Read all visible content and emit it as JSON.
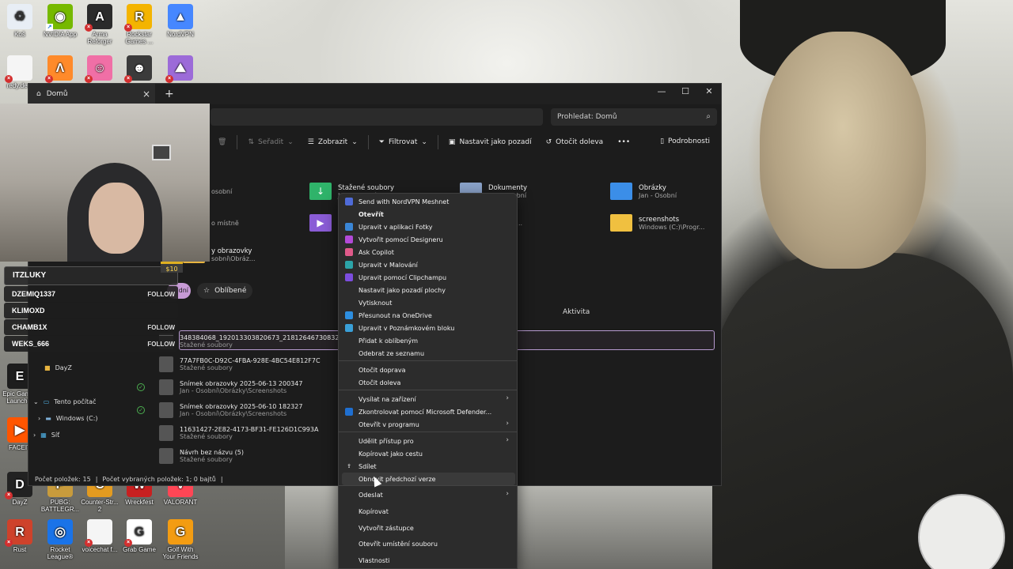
{
  "desktop": {
    "icons": [
      {
        "label": "Koš",
        "icon": "recycle-bin-icon",
        "color": "#e8eef5",
        "glyph": "♻",
        "badge": ""
      },
      {
        "label": "NVIDIA App",
        "icon": "nvidia-icon",
        "color": "#76b900",
        "glyph": "◉",
        "badge": "arrow"
      },
      {
        "label": "Arma Reforger",
        "icon": "arma-icon",
        "color": "#2b2b2b",
        "glyph": "A",
        "badge": "x"
      },
      {
        "label": "Rockstar Games ...",
        "icon": "rockstar-icon",
        "color": "#f4b400",
        "glyph": "R",
        "badge": "x"
      },
      {
        "label": "NordVPN",
        "icon": "nordvpn-icon",
        "color": "#4687ff",
        "glyph": "▲",
        "badge": ""
      },
      {
        "label": "redy.de...",
        "icon": "file-icon",
        "color": "#f5f5f5",
        "glyph": "",
        "badge": "x"
      },
      {
        "label": "",
        "icon": "fl-studio-icon",
        "color": "#ff8a2a",
        "glyph": "Λ",
        "badge": "x"
      },
      {
        "label": "",
        "icon": "mascot-icon",
        "color": "#f06fa6",
        "glyph": "☺",
        "badge": "x"
      },
      {
        "label": "",
        "icon": "character-icon",
        "color": "#3b3b3b",
        "glyph": "☻",
        "badge": "x"
      },
      {
        "label": "",
        "icon": "mountain-icon",
        "color": "#9c6bd8",
        "glyph": "⛰",
        "badge": "x"
      },
      {
        "label": "Epic Games Launcher",
        "icon": "epic-games-icon",
        "color": "#1d1d1d",
        "glyph": "E",
        "badge": ""
      },
      {
        "label": "FACEIT",
        "icon": "faceit-icon",
        "color": "#ff5500",
        "glyph": "▶",
        "badge": ""
      },
      {
        "label": "DayZ",
        "icon": "dayz-icon",
        "color": "#222",
        "glyph": "D",
        "badge": "x"
      },
      {
        "label": "PUBG: BATTLEGR...",
        "icon": "pubg-icon",
        "color": "#c89b3c",
        "glyph": "P",
        "badge": ""
      },
      {
        "label": "Counter-Str... 2",
        "icon": "cs2-icon",
        "color": "#e39b20",
        "glyph": "C",
        "badge": ""
      },
      {
        "label": "Wreckfest",
        "icon": "wreckfest-icon",
        "color": "#c82020",
        "glyph": "W",
        "badge": ""
      },
      {
        "label": "VALORANT",
        "icon": "valorant-icon",
        "color": "#ff4655",
        "glyph": "V",
        "badge": ""
      },
      {
        "label": "Rust",
        "icon": "rust-icon",
        "color": "#ce422b",
        "glyph": "R",
        "badge": "x"
      },
      {
        "label": "Rocket League®",
        "icon": "rocket-league-icon",
        "color": "#1a73e8",
        "glyph": "◎",
        "badge": ""
      },
      {
        "label": "voicechat f...",
        "icon": "file-icon",
        "color": "#f5f5f5",
        "glyph": "",
        "badge": "x"
      },
      {
        "label": "Grab Game",
        "icon": "grab-game-icon",
        "color": "#ffffff",
        "glyph": "G",
        "badge": "x"
      },
      {
        "label": "Golf With Your Friends",
        "icon": "golf-icon",
        "color": "#f39c12",
        "glyph": "G",
        "badge": ""
      }
    ]
  },
  "explorer": {
    "tab_title": "Domů",
    "search_placeholder": "Prohledat: Domů",
    "toolbar": {
      "sort": "Seřadit",
      "view": "Zobrazit",
      "filter": "Filtrovat",
      "set_background": "Nastavit jako pozadí",
      "rotate_left": "Otočit doleva",
      "more": "•••",
      "details": "Podrobnosti"
    },
    "quick_access": [
      {
        "name": "",
        "sub": "osobní",
        "icon": "folder-icon",
        "color": "#e8b440"
      },
      {
        "name": "Stažené soubory",
        "sub": "Jan - Osobní",
        "icon": "downloads-folder-icon",
        "color": "#2fb36a"
      },
      {
        "name": "Dokumenty",
        "sub": "Jan - Osobní",
        "icon": "documents-folder-icon",
        "color": "#8aa2c8"
      },
      {
        "name": "Obrázky",
        "sub": "Jan - Osobní",
        "icon": "pictures-folder-icon",
        "color": "#3b8ee8"
      },
      {
        "name": "",
        "sub": "o místně",
        "icon": "folder-icon",
        "color": "#e8b440"
      },
      {
        "name": "",
        "sub": "",
        "icon": "videos-folder-icon",
        "color": "#8a5cd6"
      },
      {
        "name": "",
        "sub": "obi\\Doku...",
        "icon": "folder-icon",
        "color": "#e8b440"
      },
      {
        "name": "screenshots",
        "sub": "Windows (C:)\\Progr...",
        "icon": "folder-icon",
        "color": "#f0c040"
      },
      {
        "name": "y obrazovky",
        "sub": "sobní\\Obráz...",
        "icon": "folder-icon",
        "color": "#e8b440"
      }
    ],
    "pills": {
      "recent_fragment": "dní",
      "favorites": "Oblíbené"
    },
    "activity_header": "Aktivita",
    "files": [
      {
        "name": "348384068_192013303820673_2181264673083214185_n",
        "location": "Stažené soubory",
        "synced": false
      },
      {
        "name": "77A7FB0C-D92C-4FBA-928E-4BC54E812F7C",
        "location": "Stažené soubory",
        "synced": false
      },
      {
        "name": "Snímek obrazovky 2025-06-13 200347",
        "location": "Jan - Osobní\\Obrázky\\Screenshots",
        "synced": true
      },
      {
        "name": "Snímek obrazovky 2025-06-10 182327",
        "location": "Jan - Osobní\\Obrázky\\Screenshots",
        "synced": true
      },
      {
        "name": "11631427-2E82-4173-BF31-FE126D1C993A",
        "location": "Stažené soubory",
        "synced": false
      },
      {
        "name": "Návrh bez názvu (5)",
        "location": "Stažené soubory",
        "synced": false
      }
    ],
    "nav": {
      "dayz": "DayZ",
      "this_pc": "Tento počítač",
      "windows_c": "Windows (C:)",
      "network": "Síť"
    },
    "status": {
      "count": "Počet položek: 15",
      "selected": "Počet vybraných položek: 1; 0 bajtů"
    }
  },
  "chat": {
    "title": "ITZLUKY",
    "price": "$10",
    "rows": [
      {
        "user": "DZEMIQ1337",
        "action": "FOLLOW"
      },
      {
        "user": "KLIMOXD",
        "action": ""
      },
      {
        "user": "CHAMB1X",
        "action": "FOLLOW"
      },
      {
        "user": "WEKS_666",
        "action": "FOLLOW"
      }
    ]
  },
  "context_menu": {
    "items": [
      {
        "label": "Send with NordVPN Meshnet",
        "icon": "nordvpn-meshnet-icon",
        "color": "#4f6bd8",
        "bold": false,
        "submenu": false
      },
      {
        "label": "Otevřít",
        "icon": "",
        "color": "",
        "bold": true,
        "submenu": false
      },
      {
        "label": "Upravit v aplikaci Fotky",
        "icon": "photos-icon",
        "color": "#3a86d6",
        "bold": false,
        "submenu": false
      },
      {
        "label": "Vytvořit pomocí Designeru",
        "icon": "designer-icon",
        "color": "#b24ad8",
        "bold": false,
        "submenu": false
      },
      {
        "label": "Ask Copilot",
        "icon": "copilot-icon",
        "color": "#e05a8a",
        "bold": false,
        "submenu": false
      },
      {
        "label": "Upravit v Malování",
        "icon": "paint-icon",
        "color": "#2ca4a8",
        "bold": false,
        "submenu": false
      },
      {
        "label": "Upravit pomocí Clipchampu",
        "icon": "clipchamp-icon",
        "color": "#7c4dde",
        "bold": false,
        "submenu": false
      },
      {
        "label": "Nastavit jako pozadí plochy",
        "icon": "",
        "color": "",
        "bold": false,
        "submenu": false
      },
      {
        "label": "Vytisknout",
        "icon": "",
        "color": "",
        "bold": false,
        "submenu": false
      },
      {
        "label": "Přesunout na OneDrive",
        "icon": "onedrive-icon",
        "color": "#2d8ee0",
        "bold": false,
        "submenu": false
      },
      {
        "label": "Upravit v Poznámkovém bloku",
        "icon": "notepad-icon",
        "color": "#3aa0d8",
        "bold": false,
        "submenu": false
      },
      {
        "label": "Přidat k oblíbeným",
        "icon": "",
        "color": "",
        "bold": false,
        "submenu": false
      },
      {
        "label": "Odebrat ze seznamu",
        "icon": "",
        "color": "",
        "bold": false,
        "submenu": false
      },
      {
        "label": "Otočit doprava",
        "icon": "",
        "color": "",
        "bold": false,
        "submenu": false
      },
      {
        "label": "Otočit doleva",
        "icon": "",
        "color": "",
        "bold": false,
        "submenu": false
      },
      {
        "label": "Vysílat na zařízení",
        "icon": "",
        "color": "",
        "bold": false,
        "submenu": true
      },
      {
        "label": "Zkontrolovat pomocí Microsoft Defender...",
        "icon": "defender-icon",
        "color": "#1f6fd0",
        "bold": false,
        "submenu": false
      },
      {
        "label": "Otevřít v programu",
        "icon": "",
        "color": "",
        "bold": false,
        "submenu": true
      },
      {
        "label": "Udělit přístup pro",
        "icon": "",
        "color": "",
        "bold": false,
        "submenu": true
      },
      {
        "label": "Kopírovat jako cestu",
        "icon": "",
        "color": "",
        "bold": false,
        "submenu": false
      },
      {
        "label": "Sdílet",
        "icon": "share-icon",
        "color": "",
        "bold": false,
        "submenu": false
      },
      {
        "label": "Obnovit předchozí verze",
        "icon": "",
        "color": "",
        "bold": false,
        "submenu": false
      },
      {
        "label": "Odeslat",
        "icon": "",
        "color": "",
        "bold": false,
        "submenu": true
      },
      {
        "label": "Kopírovat",
        "icon": "",
        "color": "",
        "bold": false,
        "submenu": false
      },
      {
        "label": "Vytvořit zástupce",
        "icon": "",
        "color": "",
        "bold": false,
        "submenu": false
      },
      {
        "label": "Otevřít umístění souboru",
        "icon": "",
        "color": "",
        "bold": false,
        "submenu": false
      },
      {
        "label": "Vlastnosti",
        "icon": "",
        "color": "",
        "bold": false,
        "submenu": false
      }
    ],
    "hovered_index": 21
  }
}
